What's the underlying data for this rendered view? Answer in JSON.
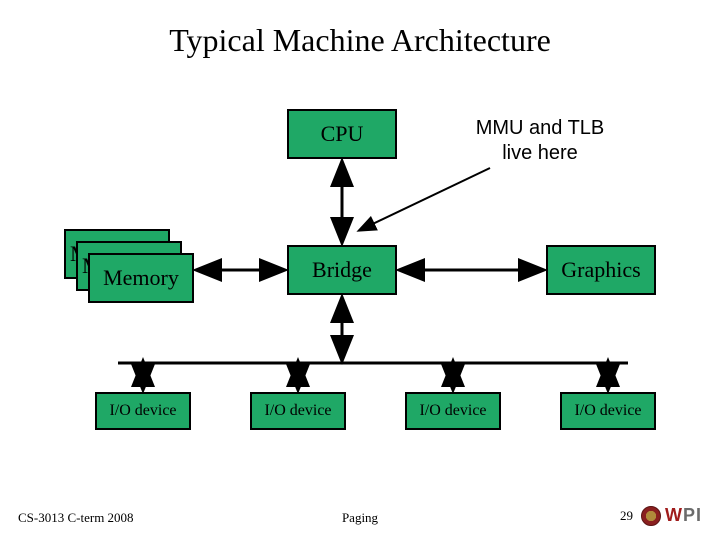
{
  "title": "Typical Machine Architecture",
  "boxes": {
    "cpu": "CPU",
    "bridge": "Bridge",
    "graphics": "Graphics",
    "memory": "Memory",
    "memory_behind1": "M",
    "memory_behind2": "M",
    "io1": "I/O device",
    "io2": "I/O device",
    "io3": "I/O device",
    "io4": "I/O device"
  },
  "annotation": {
    "line1": "MMU and TLB",
    "line2": "live here"
  },
  "footer": {
    "left": "CS-3013 C-term 2008",
    "center": "Paging",
    "slide": "29",
    "logo": "WPI"
  },
  "colors": {
    "box_fill": "#1fa866",
    "box_border": "#000000",
    "arrow": "#000000"
  }
}
